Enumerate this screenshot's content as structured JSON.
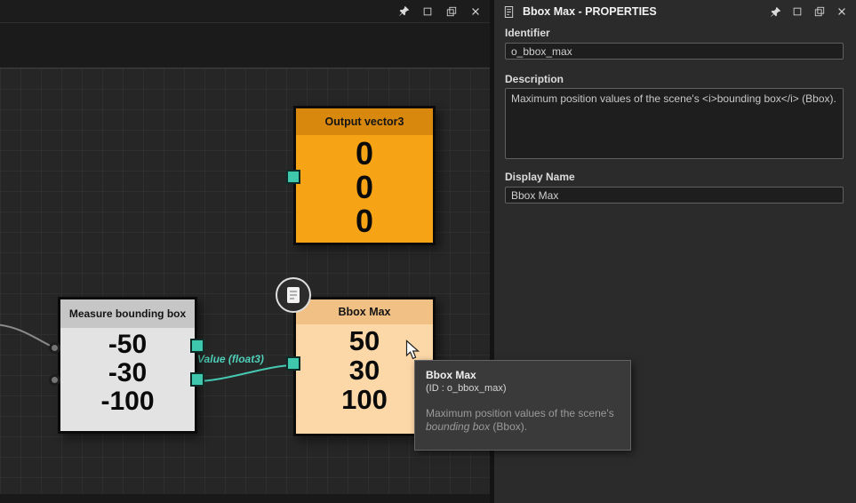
{
  "left_panel": {
    "canvas": {
      "nodes": {
        "output_vector3": {
          "title": "Output vector3",
          "values": [
            "0",
            "0",
            "0"
          ]
        },
        "measure_bounding_box": {
          "title": "Measure bounding box",
          "values": [
            "-50",
            "-30",
            "-100"
          ]
        },
        "bbox_max": {
          "title": "Bbox Max",
          "values": [
            "50",
            "30",
            "100"
          ]
        }
      },
      "wire_label": "Value (float3)",
      "tooltip": {
        "title": "Bbox Max",
        "id_line": "(ID : o_bbox_max)",
        "desc_prefix": "Maximum position values of the scene's ",
        "desc_italic": "bounding box",
        "desc_suffix": " (Bbox)."
      }
    }
  },
  "properties_panel": {
    "title": "Bbox Max - PROPERTIES",
    "identifier": {
      "label": "Identifier",
      "value": "o_bbox_max"
    },
    "description": {
      "label": "Description",
      "value": "Maximum position values of the scene's <i>bounding box</i> (Bbox)."
    },
    "display_name": {
      "label": "Display Name",
      "value": "Bbox Max"
    }
  },
  "icons": {
    "panel_toolbar": [
      "pin-icon",
      "restore-icon",
      "popout-icon",
      "close-icon"
    ],
    "properties_title_icon": "document-icon",
    "node_badge": "document-badge-icon"
  },
  "colors": {
    "accent_teal": "#3fc7ae",
    "output_node_orange": "#f6a315",
    "bbox_node_peach": "#fcd8a8",
    "measure_node_gray": "#e3e3e3"
  }
}
